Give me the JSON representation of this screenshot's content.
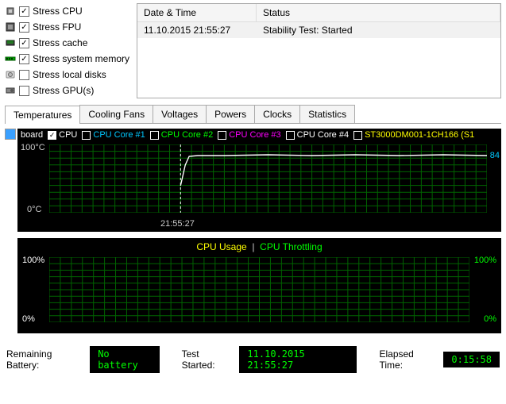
{
  "stress_options": [
    {
      "label": "Stress CPU",
      "checked": true,
      "icon": "cpu"
    },
    {
      "label": "Stress FPU",
      "checked": true,
      "icon": "fpu"
    },
    {
      "label": "Stress cache",
      "checked": true,
      "icon": "cache"
    },
    {
      "label": "Stress system memory",
      "checked": true,
      "icon": "ram"
    },
    {
      "label": "Stress local disks",
      "checked": false,
      "icon": "disk"
    },
    {
      "label": "Stress GPU(s)",
      "checked": false,
      "icon": "gpu"
    }
  ],
  "log": {
    "header_dt": "Date & Time",
    "header_status": "Status",
    "rows": [
      {
        "dt": "11.10.2015 21:55:27",
        "status": "Stability Test: Started"
      }
    ]
  },
  "tabs": [
    "Temperatures",
    "Cooling Fans",
    "Voltages",
    "Powers",
    "Clocks",
    "Statistics"
  ],
  "active_tab": 0,
  "temp_graph": {
    "legend_leading": "board",
    "series": [
      {
        "label": "CPU",
        "color": "#ffffff",
        "checked": true
      },
      {
        "label": "CPU Core #1",
        "color": "#00c8ff",
        "checked": false
      },
      {
        "label": "CPU Core #2",
        "color": "#00ff00",
        "checked": false
      },
      {
        "label": "CPU Core #3",
        "color": "#ff00ff",
        "checked": false
      },
      {
        "label": "CPU Core #4",
        "color": "#ffffff",
        "checked": false
      },
      {
        "label": "ST3000DM001-1CH166 (S1",
        "color": "#ffff00",
        "checked": false
      }
    ],
    "y_max_label": "100°C",
    "y_min_label": "0°C",
    "timestamp": "21:55:27",
    "current_value": "84"
  },
  "usage_graph": {
    "label_usage": "CPU Usage",
    "label_throttling": "CPU Throttling",
    "left_max": "100%",
    "left_min": "0%",
    "right_max": "100%",
    "right_min": "0%"
  },
  "status": {
    "battery_label": "Remaining Battery:",
    "battery_value": "No battery",
    "started_label": "Test Started:",
    "started_value": "11.10.2015 21:55:27",
    "elapsed_label": "Elapsed Time:",
    "elapsed_value": "0:15:58"
  },
  "chart_data": [
    {
      "type": "line",
      "title": "Temperatures",
      "ylabel": "°C",
      "ylim": [
        0,
        100
      ],
      "event_marker_time": "21:55:27",
      "event_marker_x_fraction": 0.3,
      "series": [
        {
          "name": "CPU",
          "color": "#ffffff",
          "points": [
            [
              0.3,
              40
            ],
            [
              0.305,
              55
            ],
            [
              0.31,
              70
            ],
            [
              0.32,
              82
            ],
            [
              0.34,
              84
            ],
            [
              0.4,
              84
            ],
            [
              0.5,
              85
            ],
            [
              0.6,
              84
            ],
            [
              0.7,
              85
            ],
            [
              0.8,
              84
            ],
            [
              0.9,
              85
            ],
            [
              1.0,
              84
            ]
          ],
          "current": 84
        }
      ]
    },
    {
      "type": "line",
      "title": "CPU Usage / Throttling",
      "ylim": [
        0,
        100
      ],
      "series": [
        {
          "name": "CPU Usage",
          "color": "#ffff00",
          "points": []
        },
        {
          "name": "CPU Throttling",
          "color": "#00ff00",
          "points": []
        }
      ]
    }
  ]
}
